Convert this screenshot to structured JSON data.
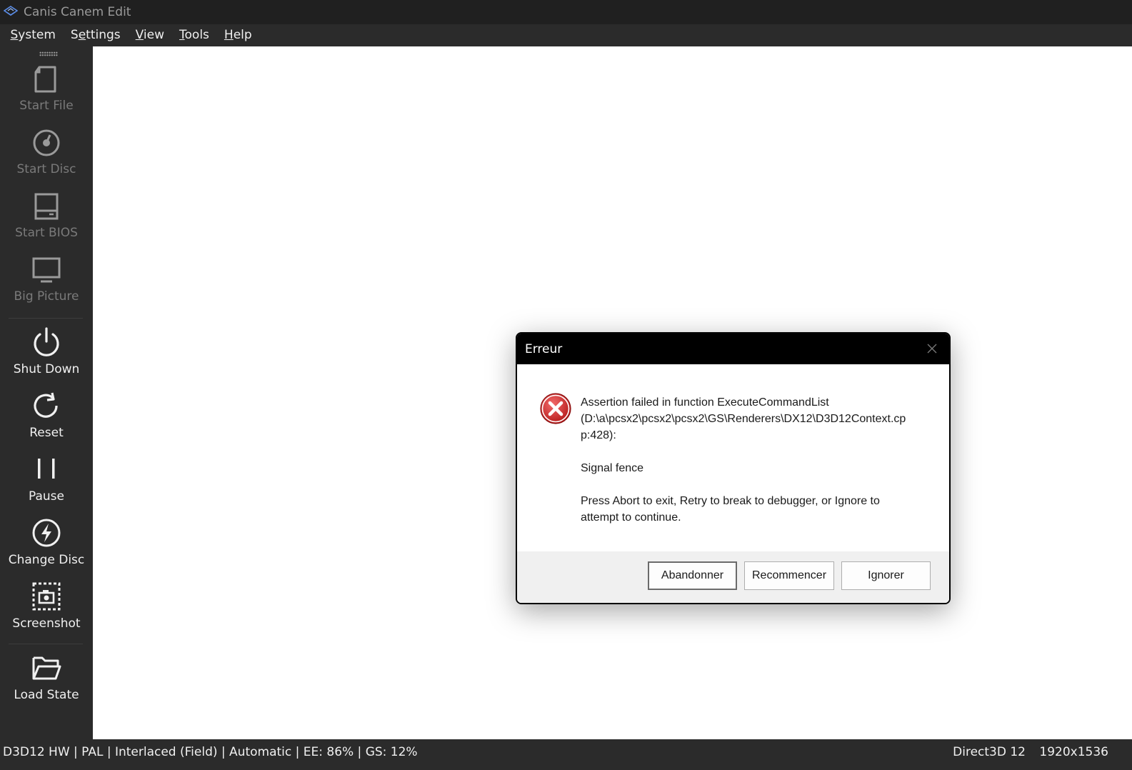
{
  "window": {
    "title": "Canis Canem Edit"
  },
  "menu": [
    "System",
    "Settings",
    "View",
    "Tools",
    "Help"
  ],
  "toolbar": {
    "start_file": "Start File",
    "start_disc": "Start Disc",
    "start_bios": "Start BIOS",
    "big_picture": "Big Picture",
    "shut_down": "Shut Down",
    "reset": "Reset",
    "pause": "Pause",
    "change_disc": "Change Disc",
    "screenshot": "Screenshot",
    "load_state": "Load State"
  },
  "status": {
    "left": "D3D12 HW | PAL | Interlaced (Field) | Automatic | EE: 86% | GS: 12%",
    "renderer": "Direct3D 12",
    "resolution": "1920x1536"
  },
  "dialog": {
    "title": "Erreur",
    "message_line1": "Assertion failed in function ExecuteCommandList",
    "message_line2": "(D:\\a\\pcsx2\\pcsx2\\pcsx2\\GS\\Renderers\\DX12\\D3D12Context.cp",
    "message_line3": "p:428):",
    "message_detail": "Signal fence",
    "message_hint_line1": "Press Abort to exit, Retry to break to debugger, or Ignore to",
    "message_hint_line2": "attempt to continue.",
    "abort_label": "Abandonner",
    "retry_label": "Recommencer",
    "ignore_label": "Ignorer"
  },
  "colors": {
    "chrome": "#2b2b2b",
    "titlebar": "#202020",
    "error_red": "#d32f2f"
  }
}
